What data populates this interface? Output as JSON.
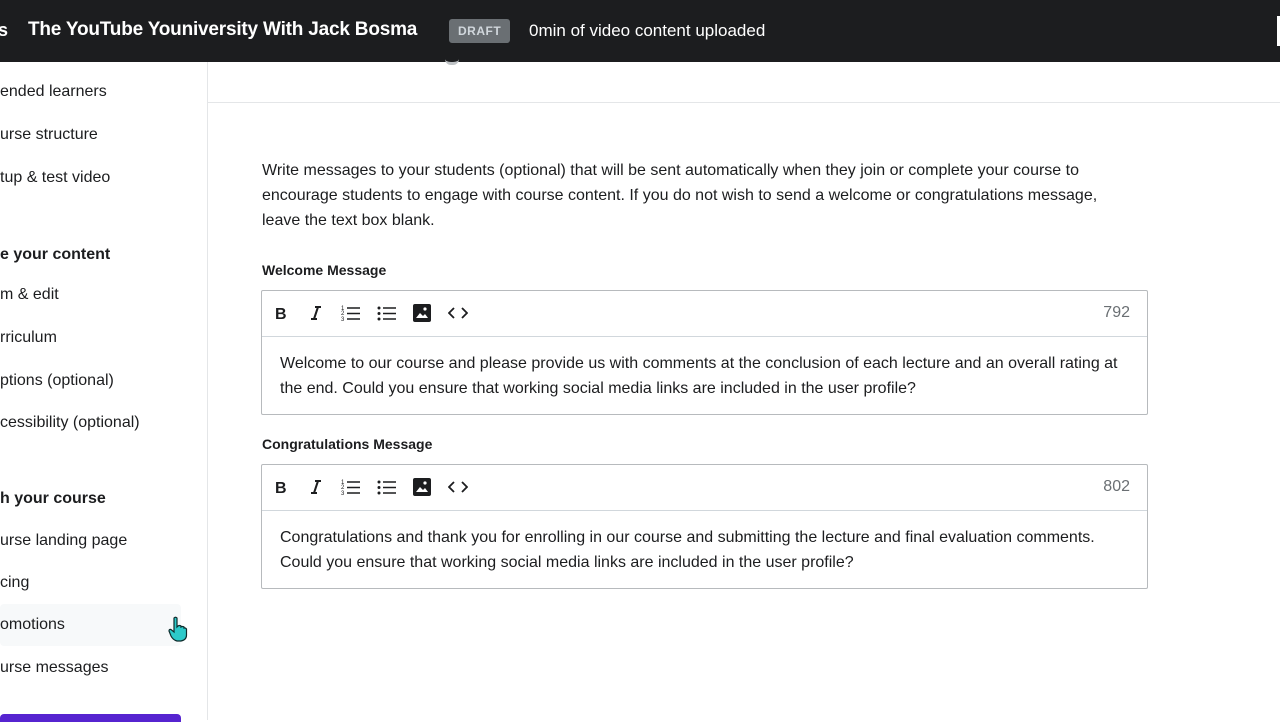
{
  "topbar": {
    "back_fragment": "s",
    "course_title": "The YouTube Youniversity With Jack Bosma",
    "status_badge": "DRAFT",
    "upload_status": "0min of video content uploaded"
  },
  "sidebar": {
    "items": [
      {
        "label": "ended learners"
      },
      {
        "label": "urse structure"
      },
      {
        "label": "tup & test video"
      }
    ],
    "group_create": "e your content",
    "create_items": [
      {
        "label": "m & edit"
      },
      {
        "label": "rriculum"
      },
      {
        "label": "ptions (optional)"
      },
      {
        "label": "cessibility (optional)"
      }
    ],
    "group_publish": "h your course",
    "publish_items": [
      {
        "label": "urse landing page"
      },
      {
        "label": "cing"
      },
      {
        "label": "omotions"
      },
      {
        "label": "urse messages"
      }
    ]
  },
  "main": {
    "intro": "Write messages to your students (optional) that will be sent automatically when they join or complete your course to encourage students to engage with course content. If you do not wish to send a welcome or congratulations message, leave the text box blank.",
    "welcome": {
      "label": "Welcome Message",
      "char_count": "792",
      "text": "Welcome to our course and please provide us with comments at the conclusion of each lecture and an overall rating at the end. Could you ensure that working social media links are included in the user profile?"
    },
    "congrats": {
      "label": "Congratulations Message",
      "char_count": "802",
      "text": "Congratulations and thank you for enrolling in our course and submitting the lecture and final evaluation comments. Could you ensure that working social media links are included in the user profile?"
    }
  },
  "colors": {
    "topbar_bg": "#1c1d1f",
    "badge_bg": "#6a6f73",
    "accent": "#5624d0",
    "cursor": "#2cc9c9"
  }
}
